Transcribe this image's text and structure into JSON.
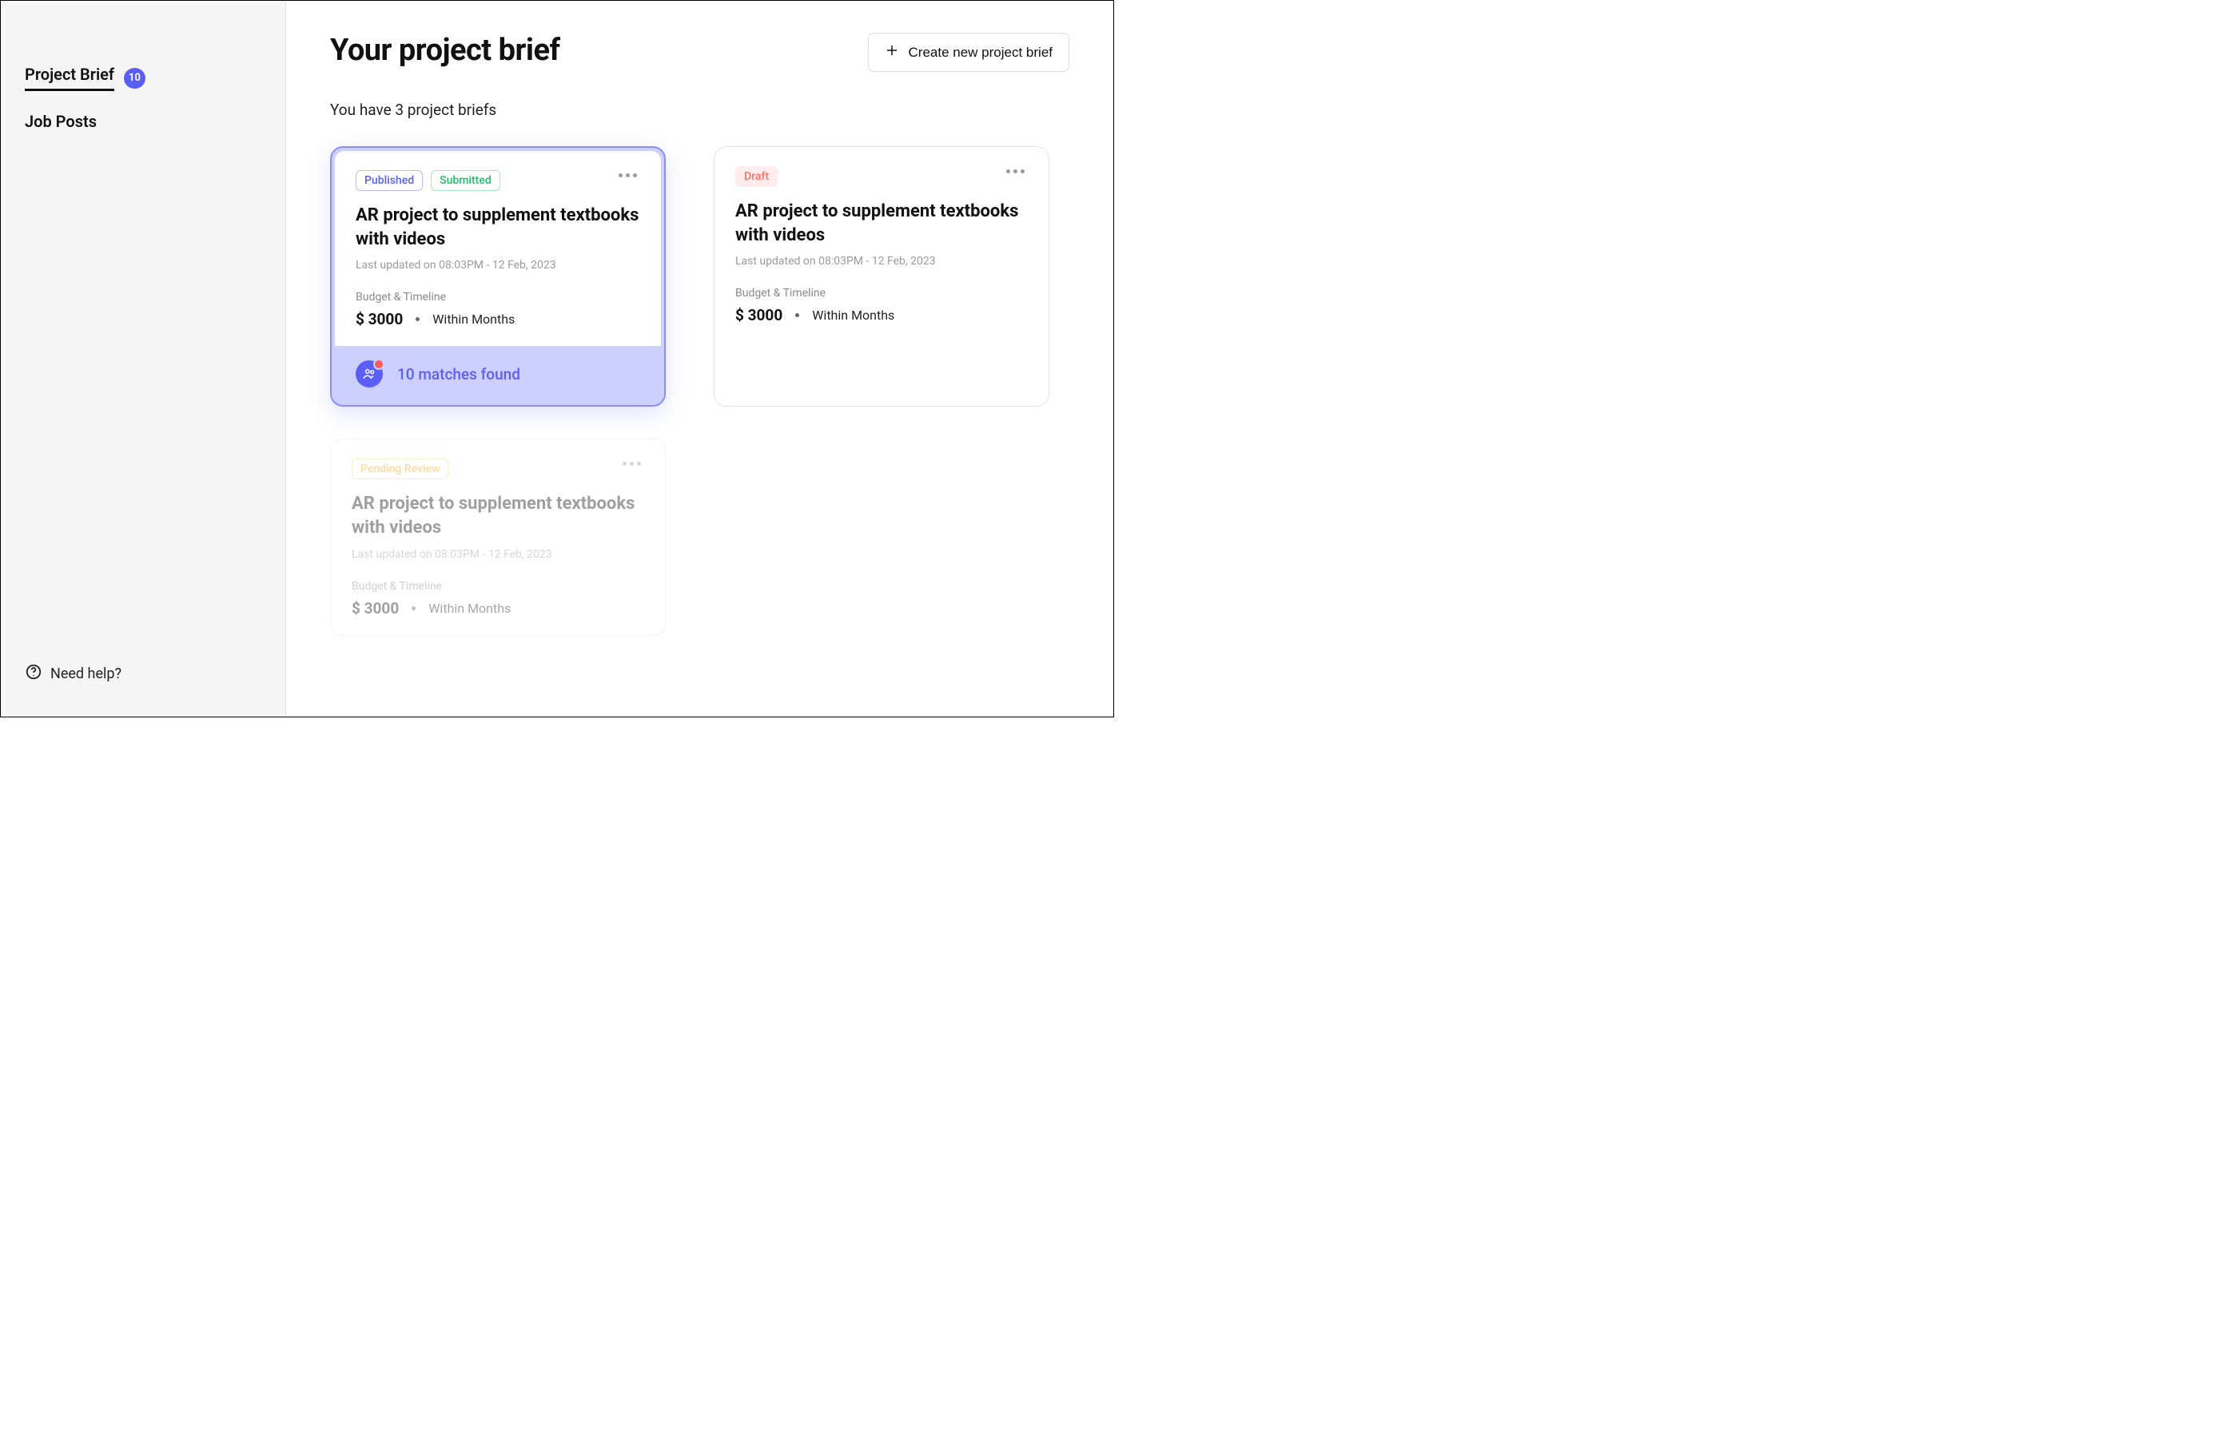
{
  "sidebar": {
    "items": [
      {
        "label": "Project Brief",
        "count": "10"
      },
      {
        "label": "Job Posts"
      }
    ],
    "help_label": "Need help?"
  },
  "header": {
    "title": "Your project brief",
    "create_label": "Create new project brief"
  },
  "subtitle": "You have 3 project briefs",
  "cards": [
    {
      "badges": [
        {
          "label": "Published",
          "style": "published"
        },
        {
          "label": "Submitted",
          "style": "submitted"
        }
      ],
      "title": "AR project to supplement textbooks with videos",
      "updated": "Last updated on 08:03PM - 12 Feb, 2023",
      "section_label": "Budget & Timeline",
      "budget": "$ 3000",
      "timeline": "Within Months",
      "matches": "10 matches found"
    },
    {
      "badges": [
        {
          "label": "Draft",
          "style": "draft"
        }
      ],
      "title": "AR project to supplement textbooks with videos",
      "updated": "Last updated on 08:03PM - 12 Feb, 2023",
      "section_label": "Budget & Timeline",
      "budget": "$ 3000",
      "timeline": "Within Months"
    },
    {
      "badges": [
        {
          "label": "Pending Review",
          "style": "pending"
        }
      ],
      "title": "AR project to supplement textbooks with videos",
      "updated": "Last updated on 08:03PM - 12 Feb, 2023",
      "section_label": "Budget & Timeline",
      "budget": "$ 3000",
      "timeline": "Within Months"
    }
  ]
}
